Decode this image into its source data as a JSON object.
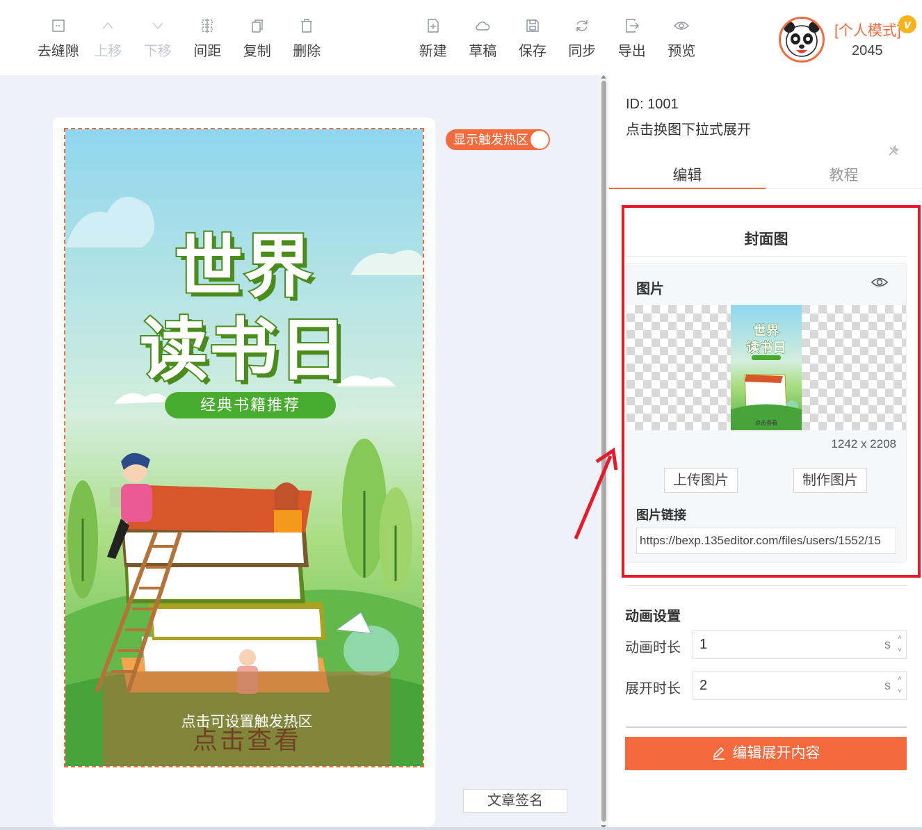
{
  "toolbar": {
    "left": [
      {
        "label": "去缝隙",
        "icon": "gap-icon",
        "enabled": true
      },
      {
        "label": "上移",
        "icon": "chevron-up-icon",
        "enabled": false
      },
      {
        "label": "下移",
        "icon": "chevron-down-icon",
        "enabled": false
      },
      {
        "label": "间距",
        "icon": "spacing-icon",
        "enabled": true
      },
      {
        "label": "复制",
        "icon": "copy-icon",
        "enabled": true
      },
      {
        "label": "删除",
        "icon": "trash-icon",
        "enabled": true
      }
    ],
    "right": [
      {
        "label": "新建",
        "icon": "new-file-icon"
      },
      {
        "label": "草稿",
        "icon": "cloud-icon"
      },
      {
        "label": "保存",
        "icon": "save-icon"
      },
      {
        "label": "同步",
        "icon": "sync-icon"
      },
      {
        "label": "导出",
        "icon": "export-icon"
      },
      {
        "label": "预览",
        "icon": "eye-icon"
      }
    ]
  },
  "user": {
    "mode": "[个人模式]",
    "vip_badge": "v",
    "id": "2045"
  },
  "canvas": {
    "poster": {
      "title_line1": "世界",
      "title_line2": "读书日",
      "subtitle": "经典书籍推荐",
      "hotzone_label": "点击可设置触发热区",
      "cta": "点击查看"
    },
    "toggle_label": "显示触发热区",
    "toggle_on": true,
    "signature_button": "文章签名"
  },
  "panel": {
    "id_text": "ID: 1001",
    "description": "点击换图下拉式展开",
    "tabs": [
      {
        "label": "编辑",
        "active": true
      },
      {
        "label": "教程",
        "active": false
      }
    ],
    "cover": {
      "title": "封面图",
      "image_header": "图片",
      "thumb_line1": "世界",
      "thumb_line2": "读书日",
      "thumb_caption": "点击查看",
      "dimensions": "1242 x 2208",
      "upload_button": "上传图片",
      "make_button": "制作图片",
      "link_label": "图片链接",
      "link_value": "https://bexp.135editor.com/files/users/1552/15"
    },
    "animation": {
      "title": "动画设置",
      "duration_label": "动画时长",
      "duration_value": "1",
      "expand_label": "展开时长",
      "expand_value": "2",
      "unit": "s"
    },
    "edit_button": "编辑展开内容"
  },
  "colors": {
    "accent": "#f36a3c",
    "highlight_box": "#e8192b",
    "title_green": "#4a8c1c"
  }
}
